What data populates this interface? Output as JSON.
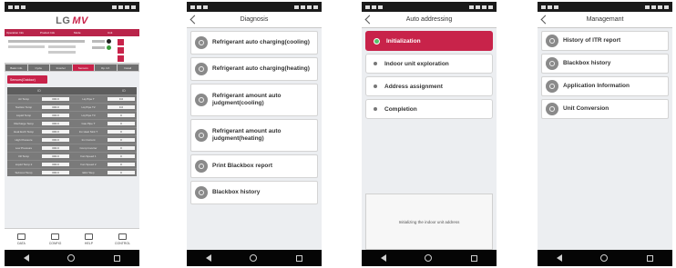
{
  "phones": {
    "p1": {
      "title_main": "LG",
      "title_accent": "MV",
      "top_tabs": [
        "Operation Info",
        "Product Info",
        "Mode",
        "Unit"
      ],
      "sub_tabs": [
        "Basic info",
        "Cycle",
        "Inverter",
        "Sensors",
        "Op. Inf.",
        "Detail"
      ],
      "chip": "Sensors(Outdoor)",
      "table_header": [
        "ID",
        "",
        "ID"
      ],
      "rows": [
        [
          "Air Temp",
          "000.0",
          "Liq Pipe T",
          "0.0"
        ],
        [
          "Suction Temp",
          "000.0",
          "Liq Pipe T2",
          "0.0"
        ],
        [
          "Liquid Temp",
          "000.0",
          "Liq Pipe T3",
          "0"
        ],
        [
          "Discharge Temp",
          "000.0",
          "Gas Pipe T",
          "0"
        ],
        [
          "Heat Exch Temp",
          "000.0",
          "Inv Heat Sink T",
          "0"
        ],
        [
          "High Pressure",
          "000.0",
          "Inv Current",
          "0"
        ],
        [
          "Low Pressure",
          "000.0",
          "Comp Inverter",
          "0"
        ],
        [
          "Oil Temp",
          "000.0",
          "Fan Speed 1",
          "0"
        ],
        [
          "Liquid Temp 2",
          "000.0",
          "Fan Speed 2",
          "0"
        ],
        [
          "Subcool Temp",
          "000.0",
          "EEV Step",
          "0"
        ]
      ],
      "bottom_nav": [
        "DATA",
        "CONFIG",
        "HELP",
        "CONTROL"
      ]
    },
    "p2": {
      "title": "Diagnosis",
      "items": [
        "Refrigerant auto charging(cooling)",
        "Refrigerant auto charging(heating)",
        "Refrigerant amount auto judgment(cooling)",
        "Refrigerant amount auto judgment(heating)",
        "Print Blackbox report",
        "Blackbox history"
      ]
    },
    "p3": {
      "title": "Auto addressing",
      "steps": [
        "Initialization",
        "Indoor unit exploration",
        "Address assignment",
        "Completion"
      ],
      "status": "Initializing the indoor unit address"
    },
    "p4": {
      "title": "Managemant",
      "items": [
        "History of ITR report",
        "Blackbox history",
        "Application Information",
        "Unit Conversion"
      ]
    }
  },
  "colors": {
    "accent": "#c8234a",
    "active_dot": "#55c26a"
  }
}
